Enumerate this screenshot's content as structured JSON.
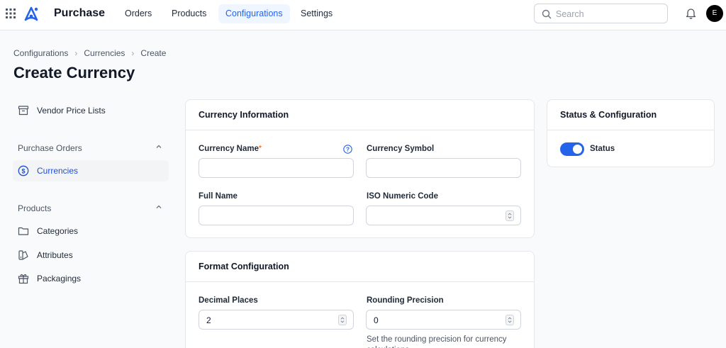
{
  "app": {
    "name": "Purchase",
    "avatar_initial": "E"
  },
  "nav": {
    "orders": "Orders",
    "products": "Products",
    "configurations": "Configurations",
    "settings": "Settings"
  },
  "search": {
    "placeholder": "Search"
  },
  "breadcrumb": [
    "Configurations",
    "Currencies",
    "Create"
  ],
  "page": {
    "title": "Create Currency"
  },
  "sidebar": {
    "vendor_price_lists": "Vendor Price Lists",
    "group_purchase_orders": "Purchase Orders",
    "currencies": "Currencies",
    "group_products": "Products",
    "categories": "Categories",
    "attributes": "Attributes",
    "packagings": "Packagings"
  },
  "currency_info": {
    "title": "Currency Information",
    "currency_name_label": "Currency Name",
    "required_marker": "*",
    "currency_name_value": "",
    "currency_symbol_label": "Currency Symbol",
    "currency_symbol_value": "",
    "full_name_label": "Full Name",
    "full_name_value": "",
    "iso_numeric_code_label": "ISO Numeric Code",
    "iso_numeric_code_value": ""
  },
  "format_config": {
    "title": "Format Configuration",
    "decimal_places_label": "Decimal Places",
    "decimal_places_value": "2",
    "rounding_precision_label": "Rounding Precision",
    "rounding_precision_value": "0",
    "rounding_hint": "Set the rounding precision for currency calculations"
  },
  "status_config": {
    "title": "Status & Configuration",
    "status_label": "Status",
    "status_enabled": true
  },
  "colors": {
    "accent": "#2563eb",
    "required": "#f97316"
  }
}
